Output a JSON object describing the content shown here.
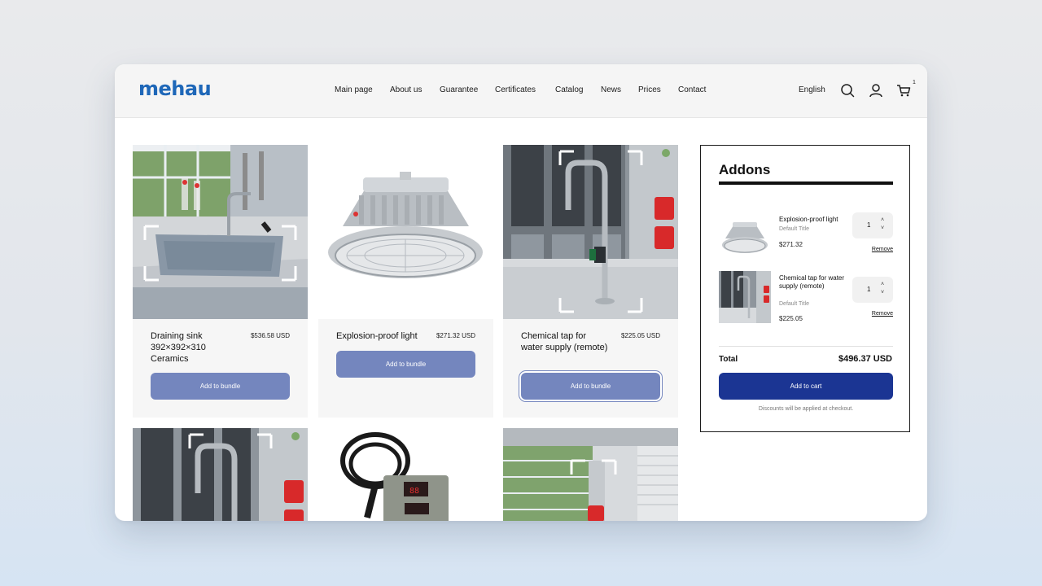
{
  "header": {
    "logo": "mehau",
    "nav": [
      "Main page",
      "About us",
      "Guarantee",
      "Certificates",
      "Catalog",
      "News",
      "Prices",
      "Contact"
    ],
    "language": "English",
    "cart_count": "1",
    "icons": [
      "search-icon",
      "user-icon",
      "cart-icon"
    ]
  },
  "products": [
    {
      "name": "Draining sink 392×392×310 Ceramics",
      "price": "$536.58 USD",
      "button": "Add to bundle"
    },
    {
      "name": "Explosion-proof light",
      "price": "$271.32 USD",
      "button": "Add to bundle"
    },
    {
      "name": "Chemical tap for water supply (remote)",
      "price": "$225.05 USD",
      "button": "Add to bundle"
    }
  ],
  "addons": {
    "title": "Addons",
    "items": [
      {
        "name": "Explosion-proof light",
        "variant": "Default Title",
        "price": "$271.32",
        "qty": "1",
        "remove": "Remove"
      },
      {
        "name": "Chemical tap for water supply (remote)",
        "variant": "Default Title",
        "price": "$225.05",
        "qty": "1",
        "remove": "Remove"
      }
    ],
    "total_label": "Total",
    "total_value": "$496.37 USD",
    "cta": "Add to cart",
    "note": "Discounts will be applied at checkout."
  },
  "colors": {
    "brand": "#1e67b8",
    "bundle_button": "#7486be",
    "cart_button": "#1b3593"
  }
}
